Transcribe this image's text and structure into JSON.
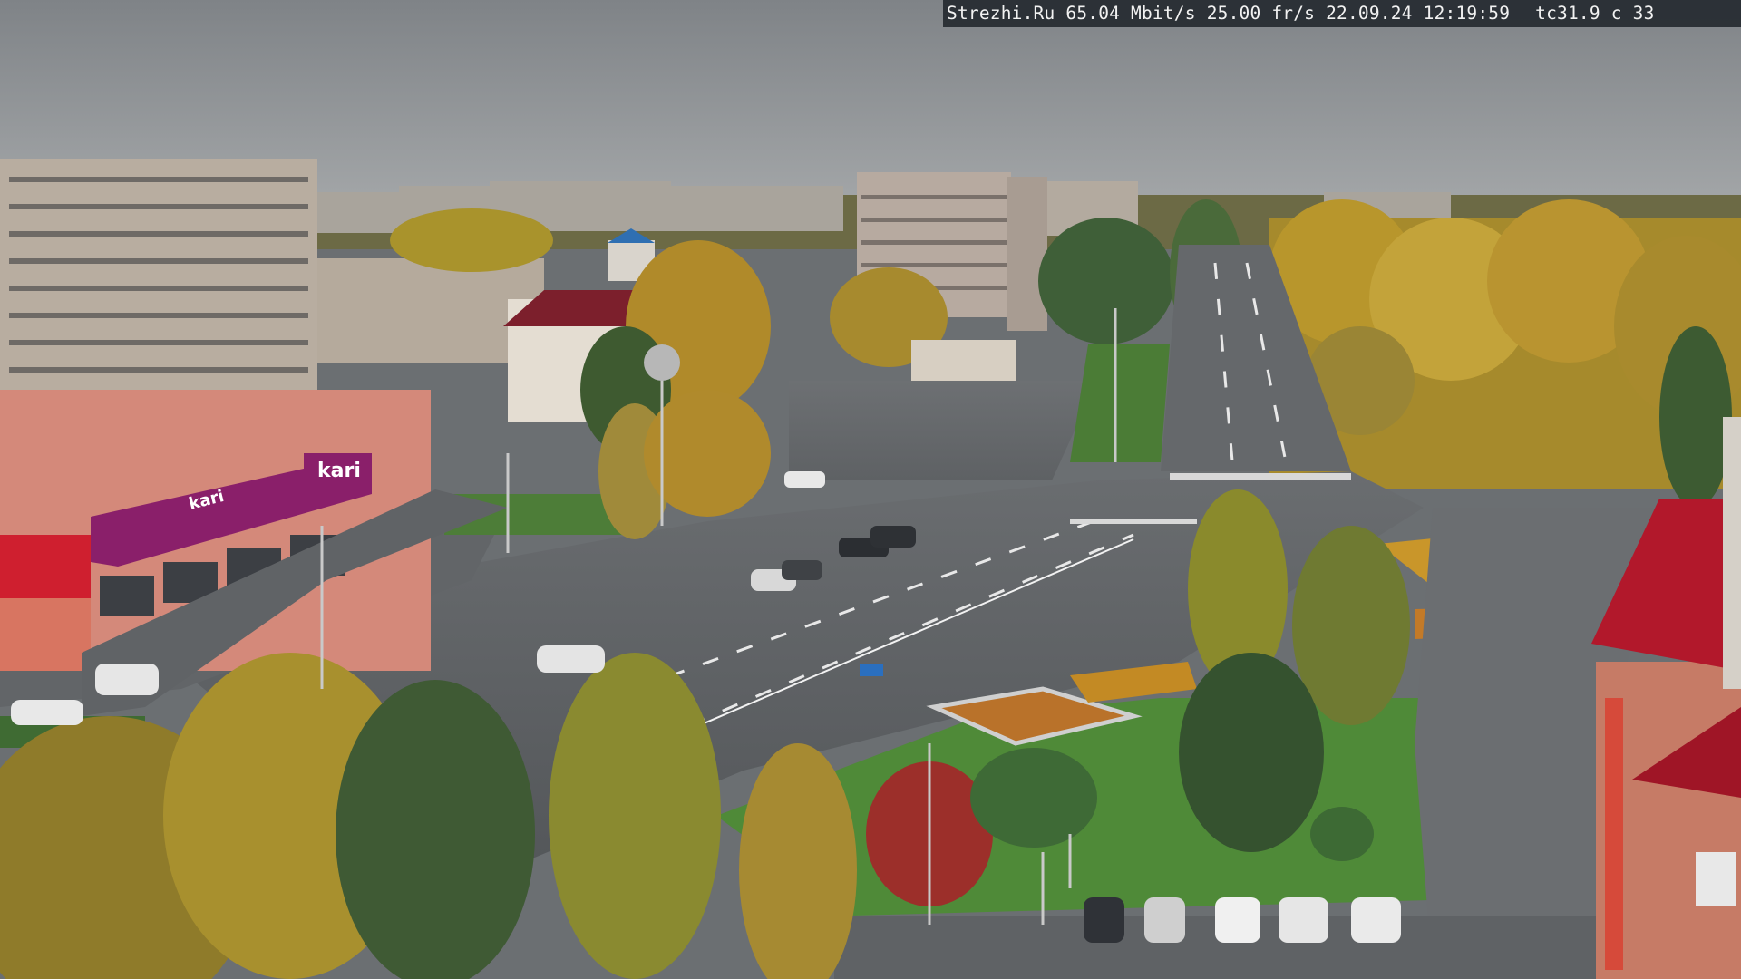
{
  "overlay": {
    "site": "Strezhi.Ru",
    "bitrate": "65.04 Mbit/s",
    "framerate": "25.00 fr/s",
    "date": "22.09.24",
    "time": "12:19:59",
    "tc": "tc31.9",
    "c": "c 33"
  },
  "signs": {
    "store_main": "kari",
    "store_banner": "kari"
  },
  "colors": {
    "sky": "#8e9296",
    "road": "#5b5f62",
    "grass": "#4c8a3a",
    "tree_autumn": "#c49a2a",
    "store_brand": "#8a1f6a",
    "roof_red": "#b2182b"
  }
}
